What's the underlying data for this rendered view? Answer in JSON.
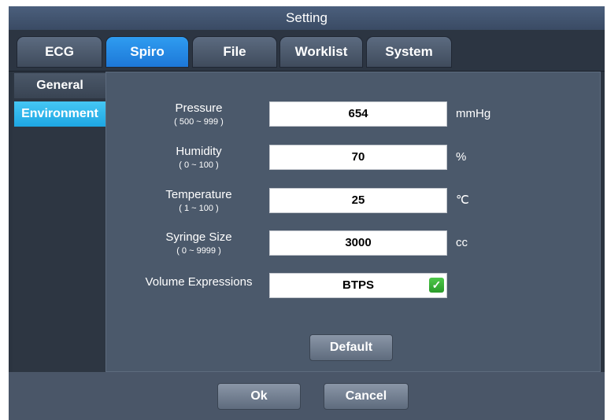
{
  "window": {
    "title": "Setting"
  },
  "tabs": [
    {
      "label": "ECG",
      "active": false
    },
    {
      "label": "Spiro",
      "active": true
    },
    {
      "label": "File",
      "active": false
    },
    {
      "label": "Worklist",
      "active": false
    },
    {
      "label": "System",
      "active": false
    }
  ],
  "sidebar": {
    "items": [
      {
        "label": "General",
        "active": false
      },
      {
        "label": "Environment",
        "active": true
      }
    ]
  },
  "form": {
    "pressure": {
      "label": "Pressure",
      "range": "( 500 ~ 999 )",
      "value": "654",
      "unit": "mmHg"
    },
    "humidity": {
      "label": "Humidity",
      "range": "( 0 ~ 100 )",
      "value": "70",
      "unit": "%"
    },
    "temperature": {
      "label": "Temperature",
      "range": "( 1 ~ 100 )",
      "value": "25",
      "unit": "℃"
    },
    "syringe": {
      "label": "Syringe Size",
      "range": "( 0 ~ 9999 )",
      "value": "3000",
      "unit": "cc"
    },
    "volume": {
      "label": "Volume Expressions",
      "value": "BTPS",
      "checked": true
    }
  },
  "buttons": {
    "default_label": "Default",
    "ok_label": "Ok",
    "cancel_label": "Cancel"
  },
  "colors": {
    "accent_tab": "#1d78d8",
    "accent_side": "#1ea7e3",
    "check": "#2a9b2a"
  },
  "icons": {
    "check": "checkmark-icon"
  }
}
